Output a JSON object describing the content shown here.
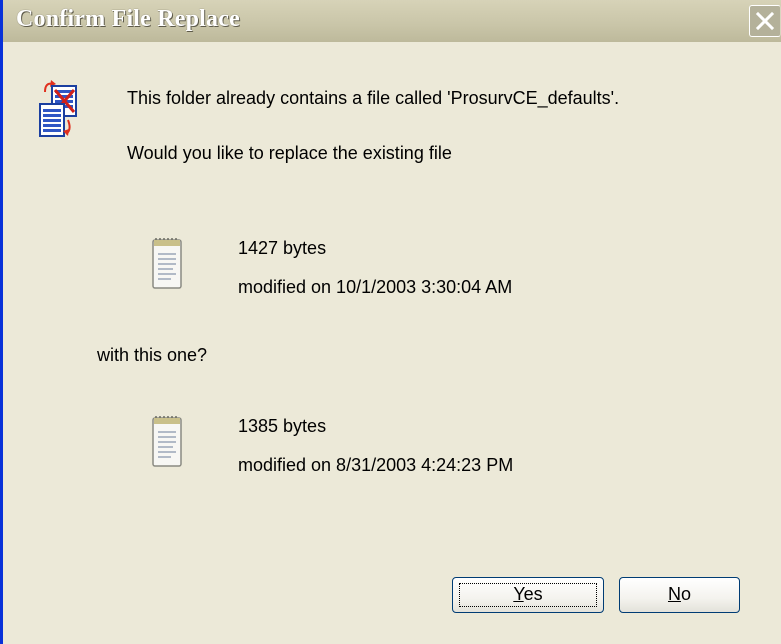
{
  "dialog": {
    "title": "Confirm File Replace",
    "message": "This folder already contains a file called 'ProsurvCE_defaults'.",
    "question": "Would you like to replace the existing file",
    "with_text": "with this one?",
    "existing_file": {
      "size": "1427 bytes",
      "modified": "modified on 10/1/2003  3:30:04 AM"
    },
    "new_file": {
      "size": "1385 bytes",
      "modified": "modified on 8/31/2003  4:24:23 PM"
    },
    "buttons": {
      "yes": {
        "mnemonic": "Y",
        "rest": "es"
      },
      "no": {
        "mnemonic": "N",
        "rest": "o"
      }
    }
  }
}
